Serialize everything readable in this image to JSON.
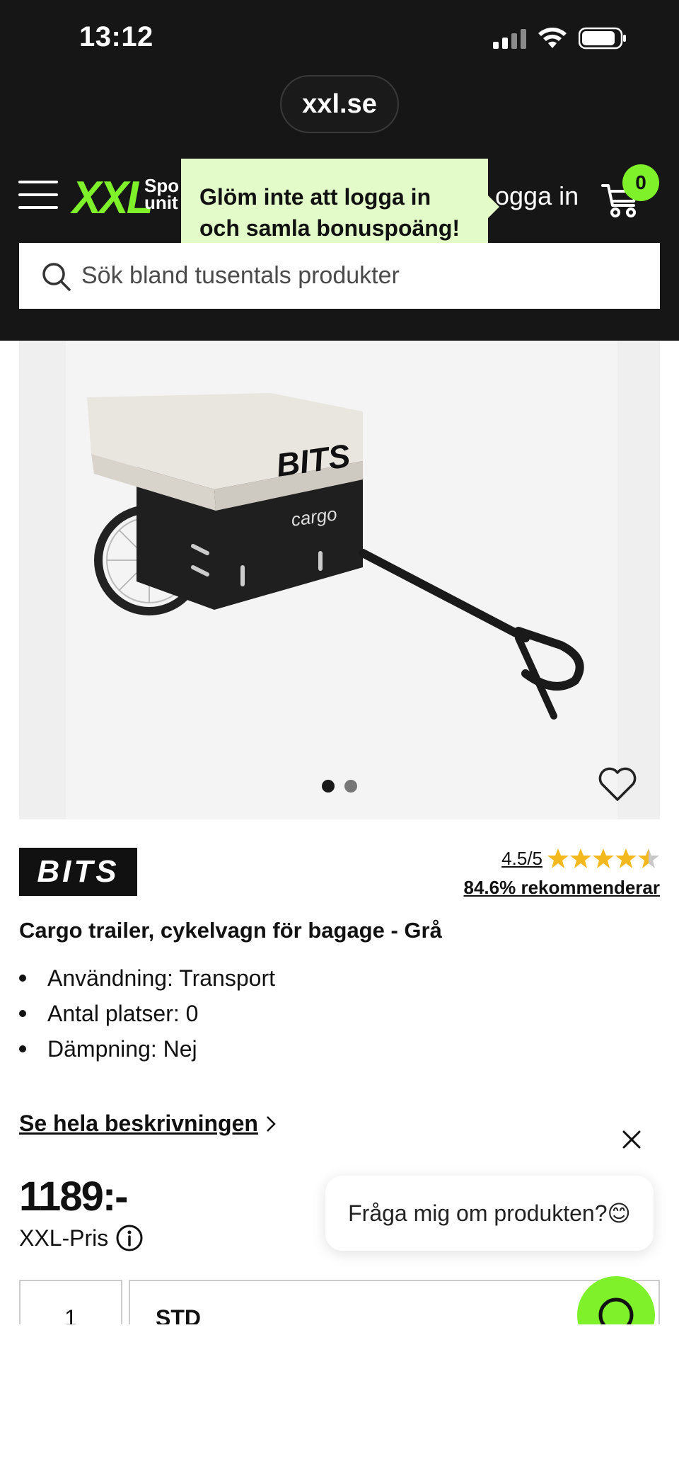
{
  "status_bar": {
    "time": "13:12"
  },
  "browser": {
    "url": "xxl.se"
  },
  "header": {
    "logo_text": "XXL",
    "logo_sub_line1": "Spo",
    "logo_sub_line2": "unit",
    "tooltip_text": "Glöm inte att logga in och samla bonuspoäng!",
    "login_label": "ogga in",
    "cart_count": "0",
    "accent_color": "#7ef12a"
  },
  "search": {
    "placeholder": "Sök bland tusentals produkter"
  },
  "gallery": {
    "image_count": 2,
    "active_index": 0
  },
  "product": {
    "brand": "BITS",
    "rating_score": "4.5/5",
    "rating_value": 4.5,
    "recommend_text": "84.6% rekommenderar",
    "title": "Cargo trailer, cykelvagn för bagage - Grå",
    "features": [
      "Användning: Transport",
      "Antal platser: 0",
      "Dämpning: Nej"
    ],
    "description_link": "Se hela beskrivningen",
    "price": "1189:-",
    "price_label": "XXL-Pris",
    "quantity": "1",
    "size": "STD"
  },
  "chat": {
    "prompt": "Fråga mig om produkten?😊"
  }
}
